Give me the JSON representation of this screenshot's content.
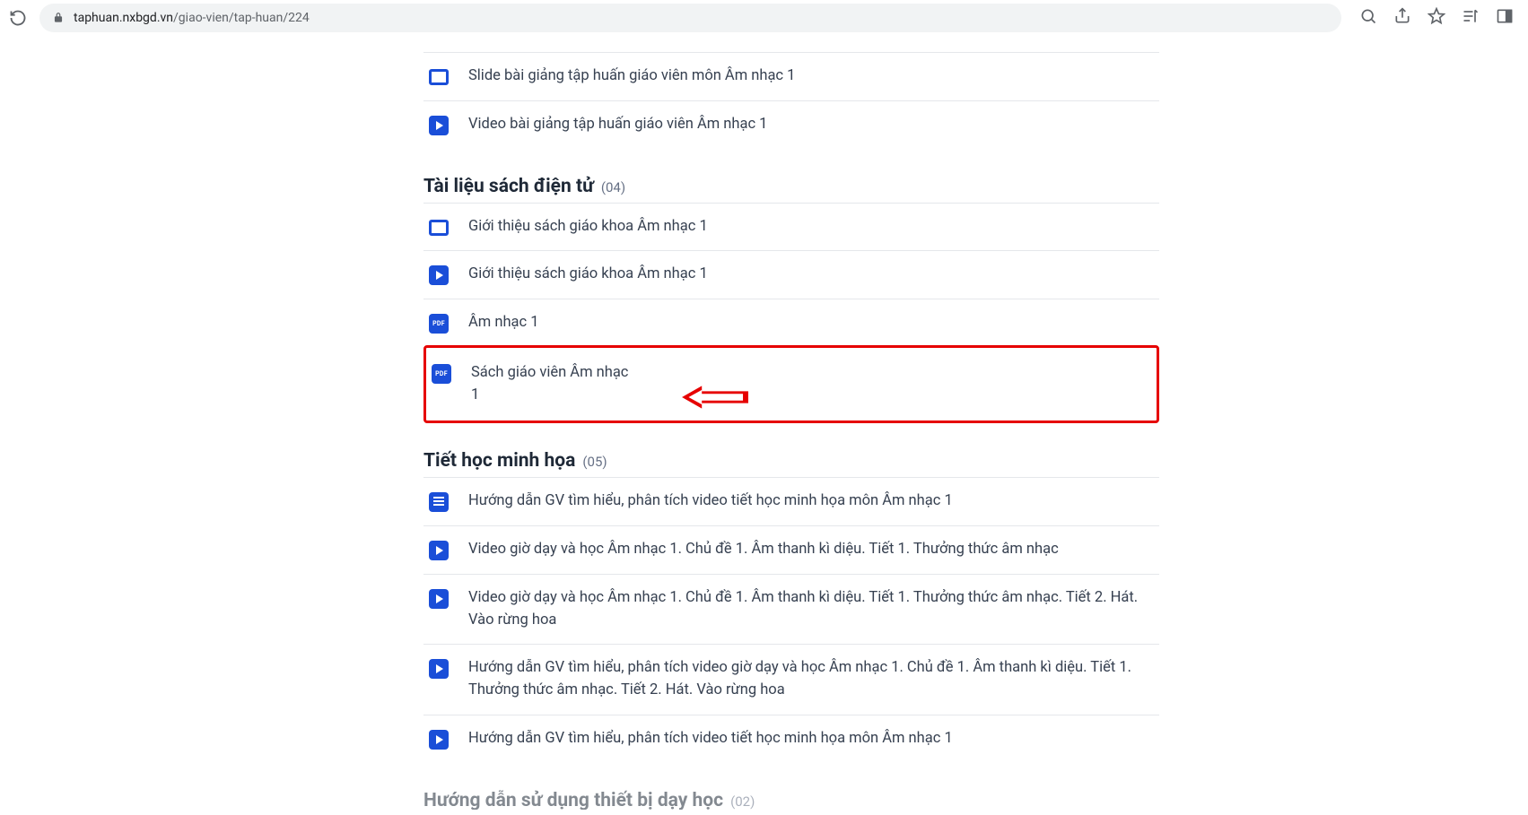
{
  "url": {
    "domain": "taphuan.nxbgd.vn",
    "path": "/giao-vien/tap-huan/224"
  },
  "section1": {
    "items": [
      {
        "icon": "slide",
        "label": "Slide bài giảng tập huấn giáo viên môn Âm nhạc 1"
      },
      {
        "icon": "video",
        "label": "Video bài giảng tập huấn giáo viên Âm nhạc 1"
      }
    ]
  },
  "section2": {
    "title": "Tài liệu sách điện tử",
    "count": "(04)",
    "items": [
      {
        "icon": "slide",
        "label": "Giới thiệu sách giáo khoa Âm nhạc 1"
      },
      {
        "icon": "video",
        "label": "Giới thiệu sách giáo khoa Âm nhạc 1"
      },
      {
        "icon": "pdf",
        "label": "Âm nhạc 1"
      },
      {
        "icon": "pdf",
        "label": "Sách giáo viên Âm nhạc 1",
        "highlight": true
      }
    ]
  },
  "section3": {
    "title": "Tiết học minh họa",
    "count": "(05)",
    "items": [
      {
        "icon": "doc",
        "label": "Hướng dẫn GV tìm hiểu, phân tích video tiết học minh họa môn Âm nhạc 1"
      },
      {
        "icon": "video",
        "label": "Video giờ dạy và học Âm nhạc 1. Chủ đề 1. Âm thanh kì diệu. Tiết 1. Thưởng thức âm nhạc"
      },
      {
        "icon": "video",
        "label": "Video giờ dạy và học Âm nhạc 1. Chủ đề 1. Âm thanh kì diệu. Tiết 1. Thưởng thức âm nhạc. Tiết 2. Hát. Vào rừng hoa"
      },
      {
        "icon": "video",
        "label": "Hướng dẫn GV tìm hiểu, phân tích video giờ dạy và học Âm nhạc 1. Chủ đề 1. Âm thanh kì diệu. Tiết 1. Thưởng thức âm nhạc. Tiết 2. Hát. Vào rừng hoa"
      },
      {
        "icon": "video",
        "label": "Hướng dẫn GV tìm hiểu, phân tích video tiết học minh họa môn Âm nhạc 1"
      }
    ]
  },
  "section4": {
    "title": "Hướng dẫn sử dụng thiết bị dạy học",
    "count": "(02)"
  },
  "pdf_badge": "PDF"
}
